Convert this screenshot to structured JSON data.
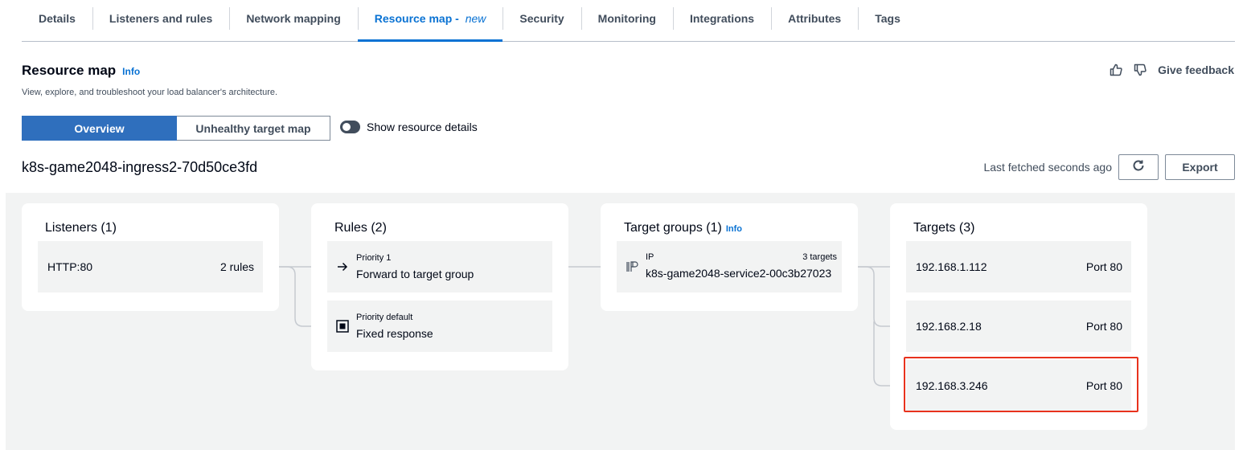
{
  "tabs": [
    {
      "label": "Details"
    },
    {
      "label": "Listeners and rules"
    },
    {
      "label": "Network mapping"
    },
    {
      "label": "Resource map - ",
      "suffix": "new",
      "active": true
    },
    {
      "label": "Security"
    },
    {
      "label": "Monitoring"
    },
    {
      "label": "Integrations"
    },
    {
      "label": "Attributes"
    },
    {
      "label": "Tags"
    }
  ],
  "header": {
    "title": "Resource map",
    "info": "Info",
    "description": "View, explore, and troubleshoot your load balancer's architecture.",
    "feedback_label": "Give feedback",
    "thumbs_up_icon": "thumbs-up-icon",
    "thumbs_down_icon": "thumbs-down-icon"
  },
  "view_toggle": {
    "overview": "Overview",
    "unhealthy": "Unhealthy target map",
    "show_details": "Show resource details"
  },
  "load_balancer": {
    "name": "k8s-game2048-ingress2-70d50ce3fd",
    "fetched": "Last fetched seconds ago",
    "refresh_icon": "refresh-icon",
    "export": "Export"
  },
  "map": {
    "listeners": {
      "title": "Listeners (1)",
      "items": [
        {
          "protocol": "HTTP:80",
          "rules": "2 rules"
        }
      ]
    },
    "rules": {
      "title": "Rules (2)",
      "items": [
        {
          "priority": "Priority 1",
          "action": "Forward to target group",
          "icon": "arrow-right-icon"
        },
        {
          "priority": "Priority default",
          "action": "Fixed response",
          "icon": "fixed-response-icon"
        }
      ]
    },
    "target_groups": {
      "title": "Target groups (1)",
      "info": "Info",
      "items": [
        {
          "type": "IP",
          "count": "3 targets",
          "name": "k8s-game2048-service2-00c3b27023",
          "icon": "ip-icon"
        }
      ]
    },
    "targets": {
      "title": "Targets (3)",
      "items": [
        {
          "ip": "192.168.1.112",
          "port": "Port 80"
        },
        {
          "ip": "192.168.2.18",
          "port": "Port 80"
        },
        {
          "ip": "192.168.3.246",
          "port": "Port 80",
          "highlighted": true
        }
      ]
    }
  },
  "colors": {
    "accent": "#0972d3",
    "segment_active": "#2f6fbd",
    "highlight": "#e8321d",
    "canvas": "#f2f3f3"
  }
}
